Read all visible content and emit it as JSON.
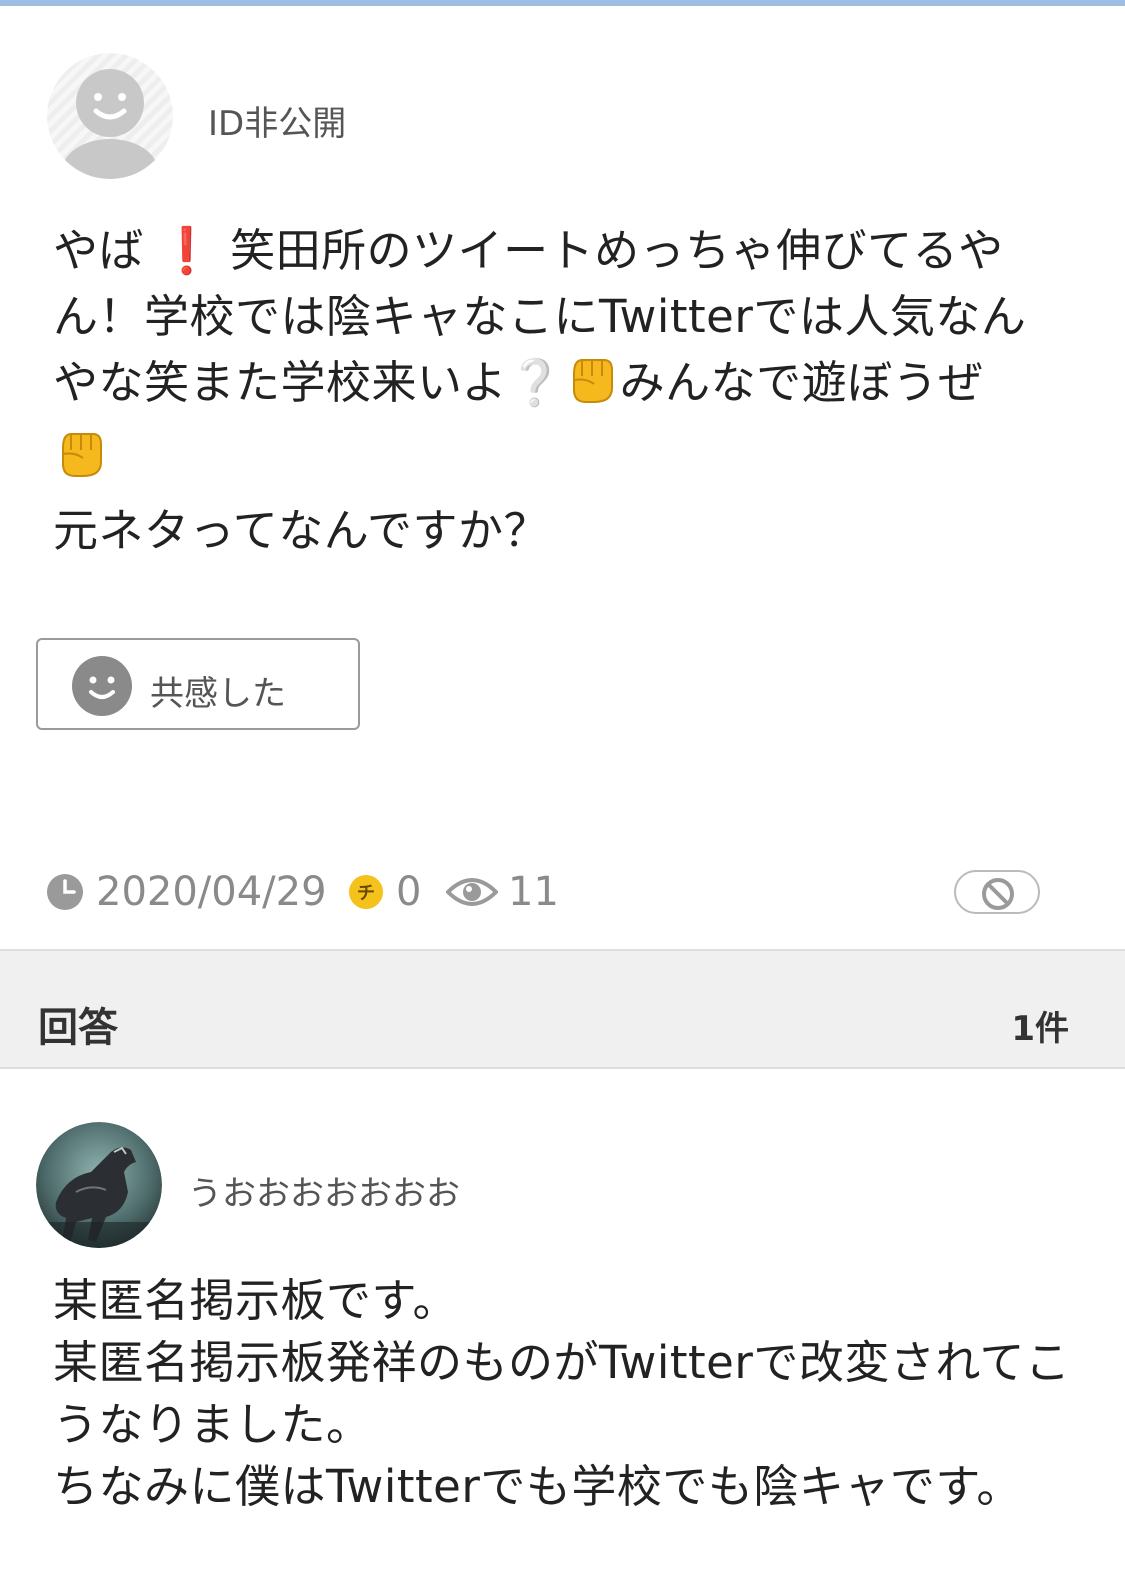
{
  "question": {
    "author": "ID非公開",
    "body_lines": [
      {
        "pre": "やば",
        "ex": "❗",
        "post": "笑田所のツイートめっちゃ伸びてるや"
      },
      {
        "text": "ん！学校では陰キャなこにTwitterでは人気なん"
      },
      {
        "pre": "やな笑また学校来いよ",
        "ex2": "❔",
        "post": "みんなで遊ぼうぜ"
      },
      {
        "text": ""
      },
      {
        "text": "元ネタってなんですか？"
      }
    ],
    "empathy_label": "共感した",
    "date": "2020/04/29",
    "coins": "0",
    "views": "11"
  },
  "answers": {
    "title": "回答",
    "count": "1件",
    "items": [
      {
        "author": "うおおおおおおお",
        "body_lines": [
          "某匿名掲示板です。",
          "某匿名掲示板発祥のものがTwitterで改変されてこ",
          "うなりました。",
          "ちなみに僕はTwitterでも学校でも陰キャです。"
        ]
      }
    ]
  },
  "icons": {
    "avatar_default": "default-avatar-icon",
    "empathy": "smiley-face-icon",
    "clock": "clock-icon",
    "coin": "coin-icon",
    "eye": "eye-icon",
    "block": "block-icon",
    "fist": "raised-fist-emoji"
  },
  "colors": {
    "accent_bar": "#9fbde0",
    "coin": "#f4c21a",
    "exclamation": "#e03525"
  }
}
